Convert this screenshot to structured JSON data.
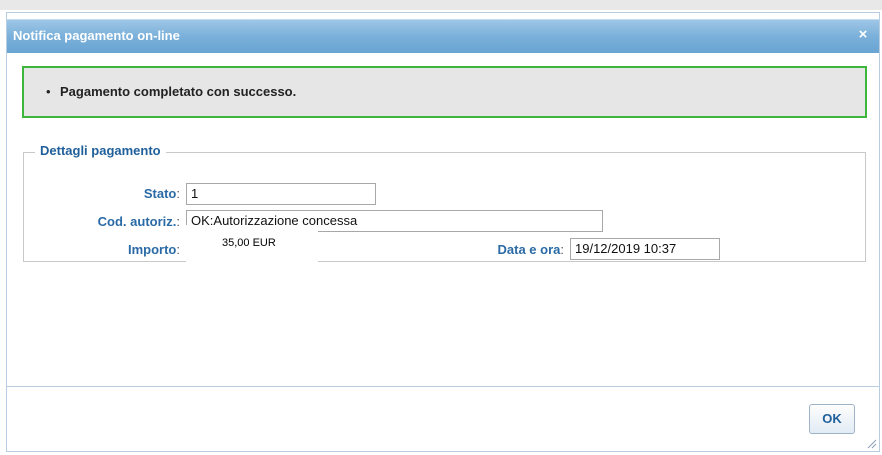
{
  "dialog": {
    "title": "Notifica pagamento on-line",
    "close_glyph": "×",
    "message": {
      "bullet": "•",
      "text": "Pagamento completato con successo.",
      "border_color": "#3cb73c"
    },
    "details": {
      "legend": "Dettagli pagamento",
      "stato": {
        "label": "Stato",
        "value": "1"
      },
      "cod_autoriz": {
        "label": "Cod. autoriz.",
        "value": "OK:Autorizzazione concessa"
      },
      "importo": {
        "label": "Importo",
        "value": "35,00 EUR"
      },
      "data_ora": {
        "label": "Data e ora",
        "value": "19/12/2019 10:37"
      }
    },
    "ok_button": "OK",
    "icons": {
      "close": "close-icon",
      "resize": "resize-grip-icon"
    }
  },
  "colors": {
    "title_bar": "#7ab0da",
    "label": "#2a6aa6",
    "message_bg": "#e6e6e6"
  }
}
